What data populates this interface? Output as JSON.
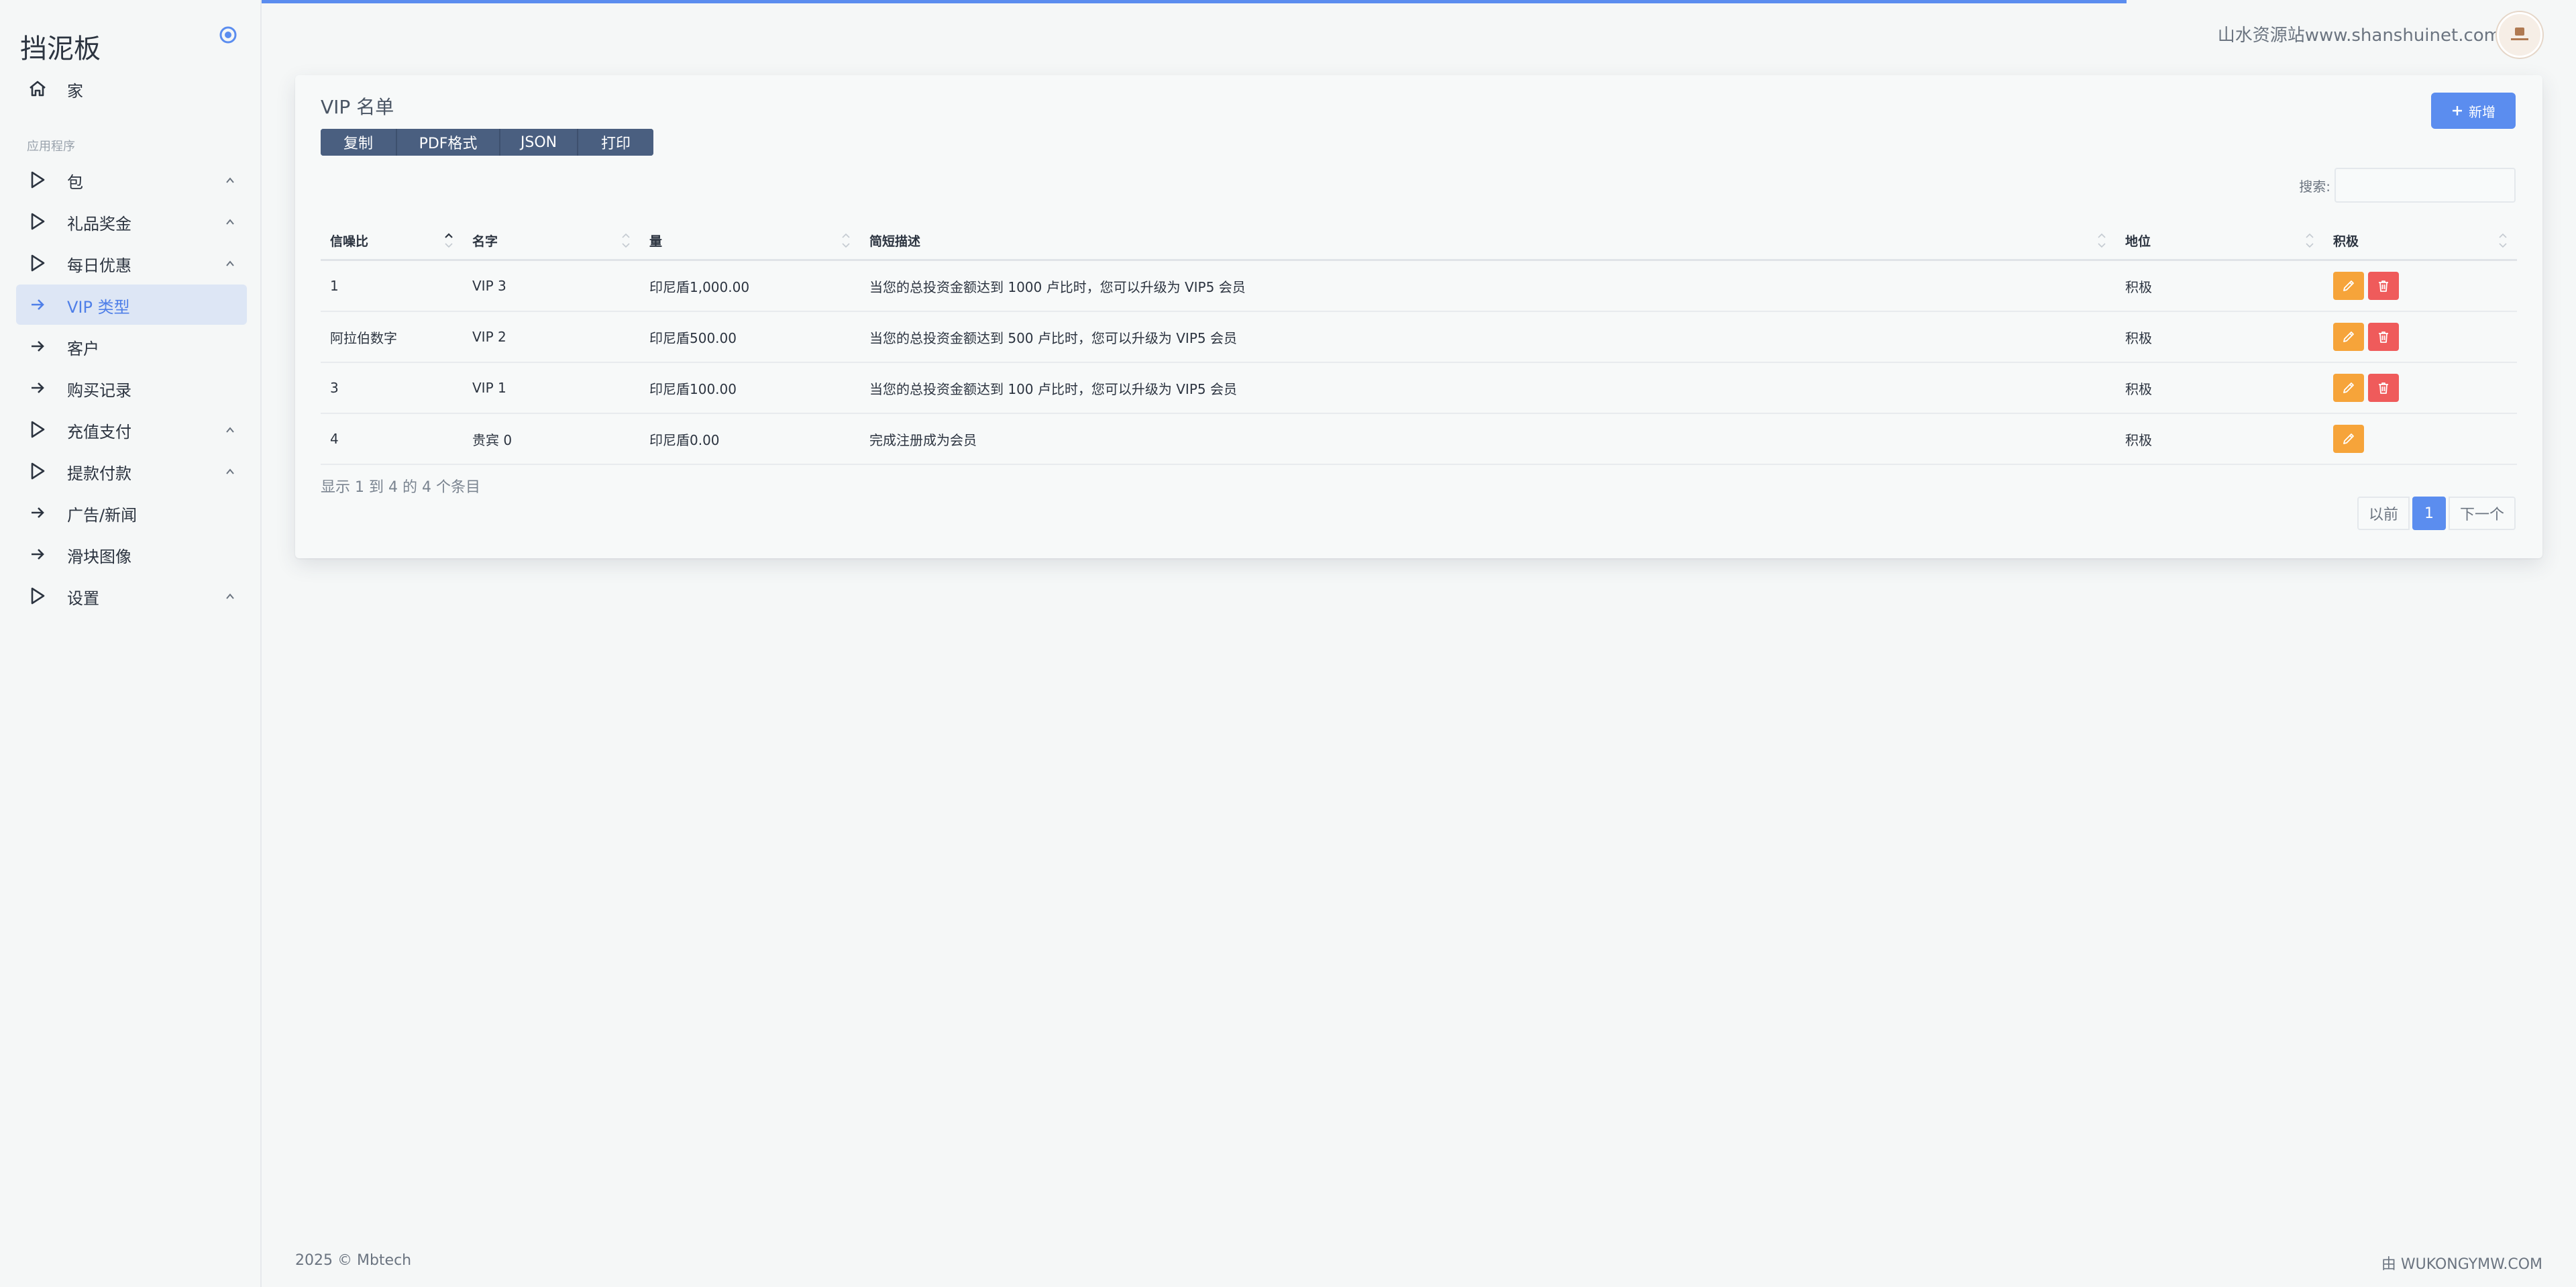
{
  "sidebar": {
    "brand": "挡泥板",
    "section_label": "应用程序",
    "items": [
      {
        "label": "家",
        "icon": "home-icon"
      },
      {
        "label": "包",
        "icon": "play-triangle-icon",
        "chevron": true
      },
      {
        "label": "礼品奖金",
        "icon": "play-triangle-icon",
        "chevron": true
      },
      {
        "label": "每日优惠",
        "icon": "play-triangle-icon",
        "chevron": true
      },
      {
        "label": "VIP 类型",
        "icon": "arrow-right-icon",
        "active": true
      },
      {
        "label": "客户",
        "icon": "arrow-right-icon"
      },
      {
        "label": "购买记录",
        "icon": "arrow-right-icon"
      },
      {
        "label": "充值支付",
        "icon": "play-triangle-icon",
        "chevron": true
      },
      {
        "label": "提款付款",
        "icon": "play-triangle-icon",
        "chevron": true
      },
      {
        "label": "广告/新闻",
        "icon": "arrow-right-icon"
      },
      {
        "label": "滑块图像",
        "icon": "arrow-right-icon"
      },
      {
        "label": "设置",
        "icon": "play-triangle-icon",
        "chevron": true
      }
    ]
  },
  "header": {
    "site_text": "山水资源站www.shanshuinet.com"
  },
  "card": {
    "title": "VIP 名单",
    "export_buttons": [
      "复制",
      "PDF格式",
      "JSON",
      "打印"
    ],
    "add_label": "新增",
    "search_label": "搜索:",
    "search_value": ""
  },
  "table": {
    "headers": [
      "信噪比",
      "名字",
      "量",
      "简短描述",
      "地位",
      "积极"
    ],
    "rows": [
      {
        "id": "1",
        "name": "VIP 3",
        "amount": "印尼盾1,000.00",
        "desc": "当您的总投资金额达到 1000 卢比时，您可以升级为 VIP5 会员",
        "status": "积极",
        "deletable": true
      },
      {
        "id": "阿拉伯数字",
        "name": "VIP 2",
        "amount": "印尼盾500.00",
        "desc": "当您的总投资金额达到 500 卢比时，您可以升级为 VIP5 会员",
        "status": "积极",
        "deletable": true
      },
      {
        "id": "3",
        "name": "VIP 1",
        "amount": "印尼盾100.00",
        "desc": "当您的总投资金额达到 100 卢比时，您可以升级为 VIP5 会员",
        "status": "积极",
        "deletable": true
      },
      {
        "id": "4",
        "name": "贵宾 0",
        "amount": "印尼盾0.00",
        "desc": "完成注册成为会员",
        "status": "积极",
        "deletable": false
      }
    ]
  },
  "pagination": {
    "info": "显示 1 到 4 的 4 个条目",
    "prev": "以前",
    "current": "1",
    "next": "下一个"
  },
  "footer": {
    "left": "2025 © Mbtech",
    "right": "由 WUKONGYMW.COM"
  },
  "colors": {
    "accent": "#5b8def",
    "edit": "#f6a43a",
    "delete": "#ef5b5b",
    "export_bg": "#4a5f80"
  }
}
